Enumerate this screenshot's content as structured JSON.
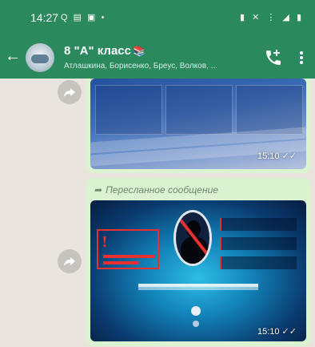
{
  "status_bar": {
    "time": "14:27",
    "left_icons": "Q ▤ ▣ •",
    "right_icons": "▮ ✕ ⋮ ◢ ▮"
  },
  "header": {
    "title": "8 \"А\" класс",
    "title_emoji": "📚",
    "subtitle": "Атлашкина, Борисенко, Бреус, Волков, ..."
  },
  "messages": [
    {
      "type": "image",
      "time": "15:10",
      "ticks": "✓✓"
    },
    {
      "type": "image",
      "forwarded_label": "Пересланное сообщение",
      "time": "15:10",
      "ticks": "✓✓"
    }
  ],
  "colors": {
    "header_bg": "#2a8a5e",
    "chat_bg": "#e9e4de",
    "bubble_bg": "#dcf3d1"
  }
}
